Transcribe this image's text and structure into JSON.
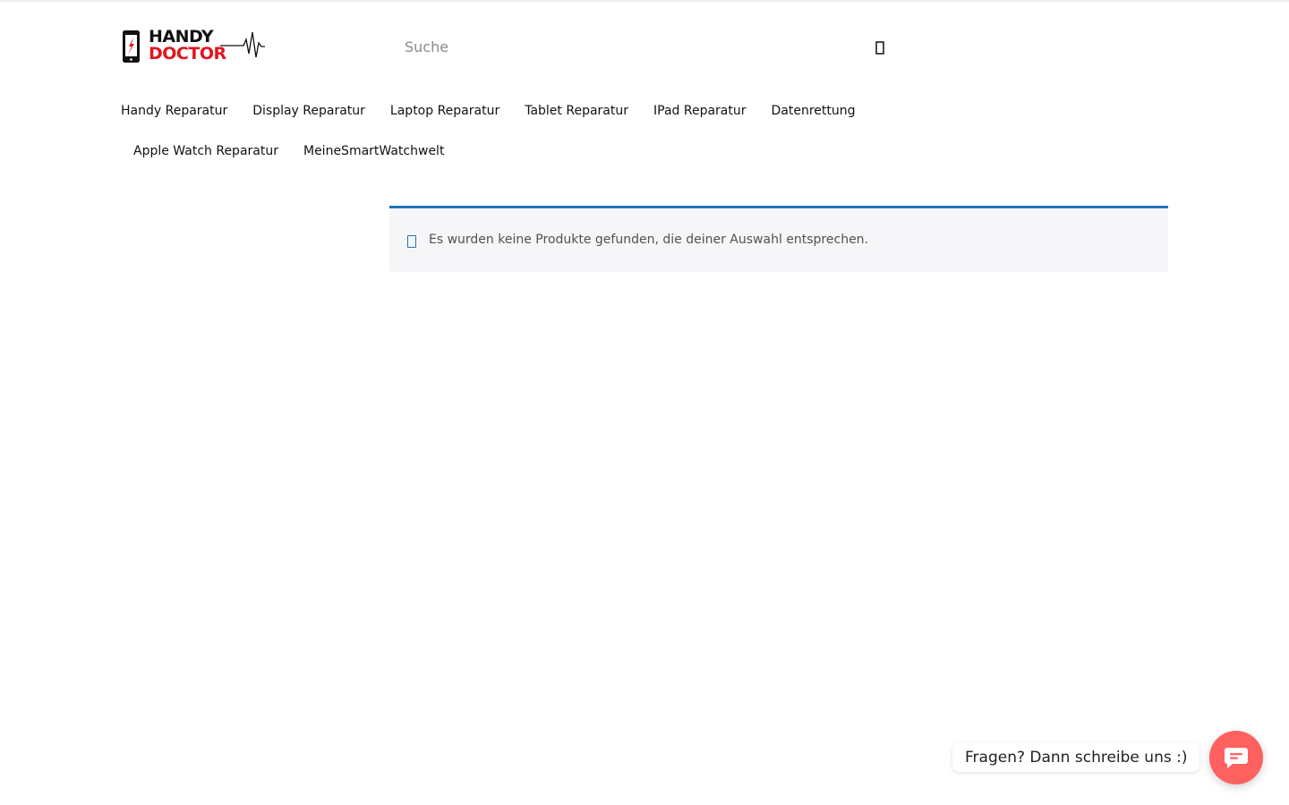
{
  "brand": {
    "logo_line1": "HANDY",
    "logo_line2": "DOCTOR",
    "logo_icon": "phone-heartbeat-logo-icon",
    "primary_red": "#e0161e"
  },
  "search": {
    "placeholder": "Suche",
    "icon": "search-icon"
  },
  "nav": {
    "row1": [
      {
        "label": "Handy Reparatur"
      },
      {
        "label": "Display Reparatur"
      },
      {
        "label": "Laptop Reparatur"
      },
      {
        "label": "Tablet Reparatur"
      },
      {
        "label": "IPad Reparatur"
      },
      {
        "label": "Datenrettung"
      }
    ],
    "row2": [
      {
        "label": "Apple Watch Reparatur"
      },
      {
        "label": "MeineSmartWatchwelt"
      }
    ]
  },
  "notice": {
    "message": "Es wurden keine Produkte gefunden, die deiner Auswahl entsprechen.",
    "icon": "info-icon",
    "accent_color": "#1e73be"
  },
  "chat": {
    "label": "Fragen? Dann schreibe uns :)",
    "icon": "chat-bubble-icon",
    "button_color": "#ff6060"
  }
}
